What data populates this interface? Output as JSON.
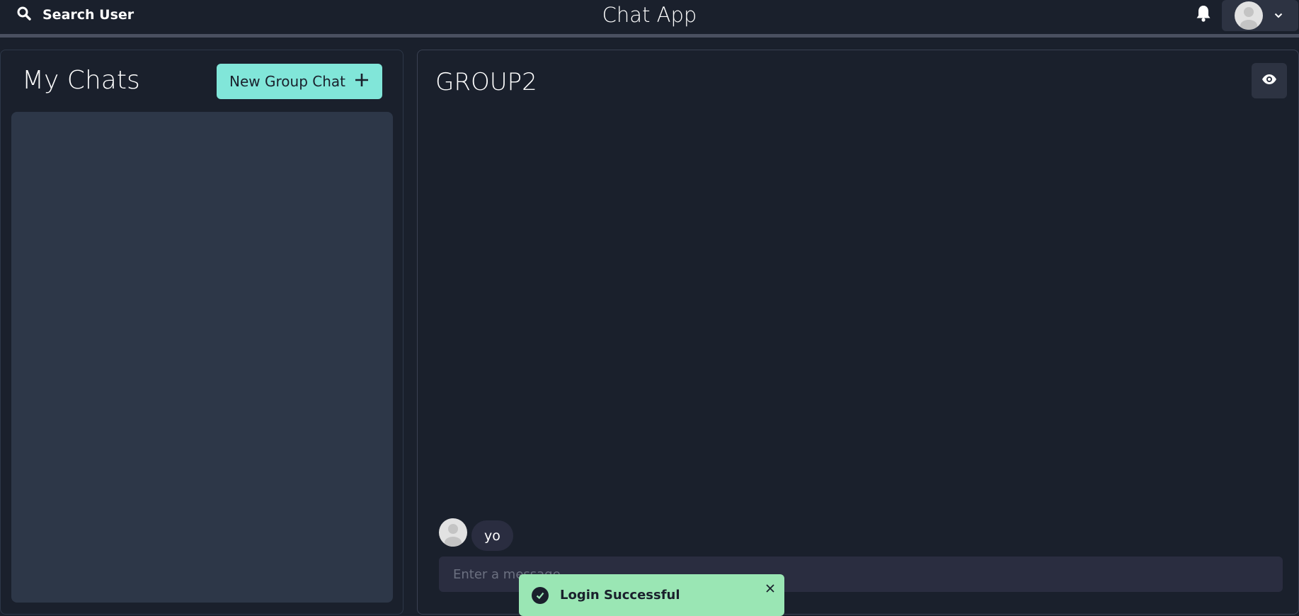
{
  "header": {
    "search_label": "Search User",
    "app_title": "Chat App",
    "icons": {
      "search": "search-icon",
      "notifications": "bell-icon",
      "profile_menu_caret": "chevron-down-icon"
    }
  },
  "sidebar": {
    "title": "My Chats",
    "new_group_label": "New Group Chat",
    "new_group_icon": "plus-icon",
    "chats": []
  },
  "chat": {
    "name": "GROUP2",
    "view_icon": "eye-icon",
    "messages": [
      {
        "text": "yo"
      }
    ],
    "input_placeholder": "Enter a message..",
    "input_value": ""
  },
  "toast": {
    "status": "success",
    "message": "Login Successful"
  },
  "colors": {
    "background": "#1a202c",
    "panel": "#2d3748",
    "accent_teal": "#81e6d9",
    "toast_green": "#9ae6b4",
    "bubble": "#2a2d40"
  }
}
